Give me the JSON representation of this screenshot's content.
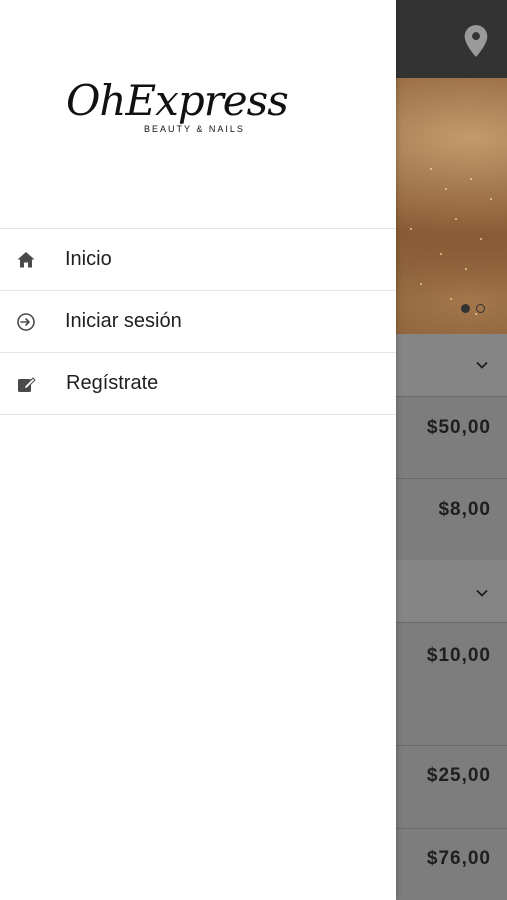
{
  "drawer": {
    "logo": {
      "script_text": "OhExpress",
      "tagline": "BEAUTY & NAILS"
    },
    "menu": [
      {
        "label": "Inicio",
        "icon": "home-icon"
      },
      {
        "label": "Iniciar sesión",
        "icon": "sign-in-icon"
      },
      {
        "label": "Regístrate",
        "icon": "edit-icon"
      }
    ]
  },
  "background": {
    "topbar_icon": "location-pin-icon",
    "carousel": {
      "current_slide": 1,
      "total_slides": 2
    },
    "sections": [
      {
        "prices": [
          "$50,00",
          "$8,00"
        ]
      },
      {
        "prices": [
          "$10,00",
          "$25,00",
          "$76,00"
        ]
      }
    ]
  },
  "colors": {
    "drawer_bg": "#ffffff",
    "overlay_gray": "#7d7d7d",
    "topbar": "#333333",
    "text": "#1f1f1f"
  }
}
